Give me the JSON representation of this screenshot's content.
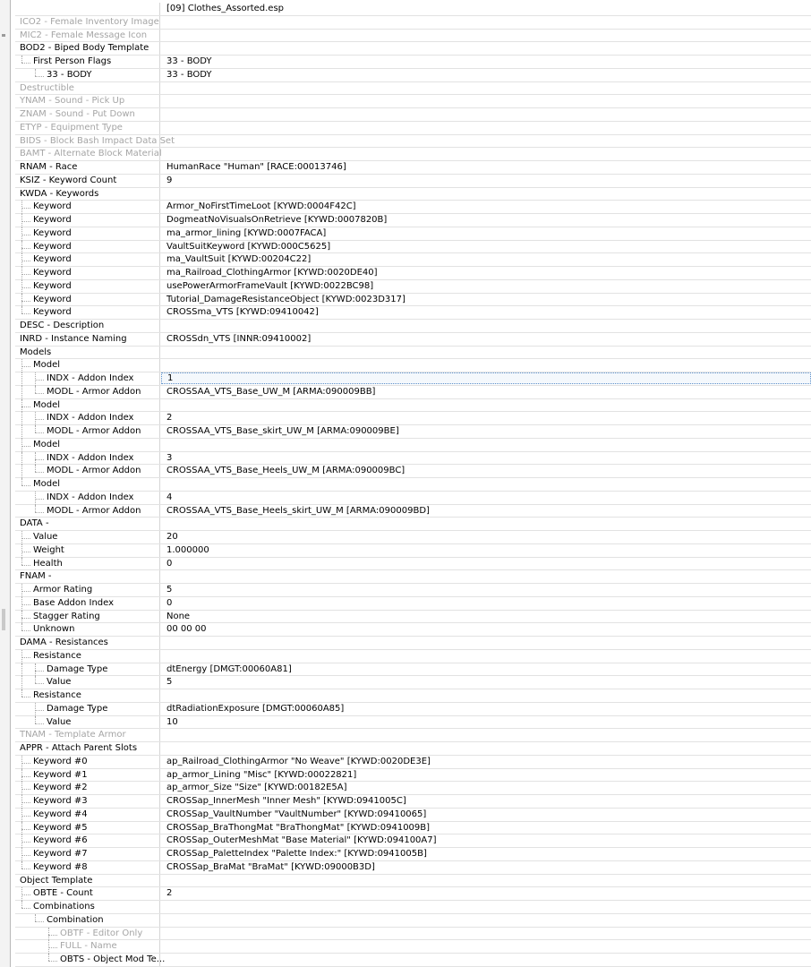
{
  "header_value": "[09] Clothes_Assorted.esp",
  "rows": [
    {
      "l": "ICO2 - Female Inventory Image",
      "v": "",
      "d": 0,
      "dim": true
    },
    {
      "l": "MIC2 - Female Message Icon",
      "v": "",
      "d": 0,
      "dim": true
    },
    {
      "l": "BOD2 - Biped Body Template",
      "v": "",
      "d": 0
    },
    {
      "l": "First Person Flags",
      "v": "33 - BODY",
      "d": 1
    },
    {
      "l": "33 - BODY",
      "v": "33 - BODY",
      "d": 2
    },
    {
      "l": "Destructible",
      "v": "",
      "d": 0,
      "dim": true
    },
    {
      "l": "YNAM - Sound - Pick Up",
      "v": "",
      "d": 0,
      "dim": true
    },
    {
      "l": "ZNAM - Sound - Put Down",
      "v": "",
      "d": 0,
      "dim": true
    },
    {
      "l": "ETYP - Equipment Type",
      "v": "",
      "d": 0,
      "dim": true
    },
    {
      "l": "BIDS - Block Bash Impact Data Set",
      "v": "",
      "d": 0,
      "dim": true
    },
    {
      "l": "BAMT - Alternate Block Material",
      "v": "",
      "d": 0,
      "dim": true
    },
    {
      "l": "RNAM - Race",
      "v": "HumanRace \"Human\" [RACE:00013746]",
      "d": 0
    },
    {
      "l": "KSIZ - Keyword Count",
      "v": "9",
      "d": 0
    },
    {
      "l": "KWDA - Keywords",
      "v": "",
      "d": 0
    },
    {
      "l": "Keyword",
      "v": "Armor_NoFirstTimeLoot [KYWD:0004F42C]",
      "d": 1
    },
    {
      "l": "Keyword",
      "v": "DogmeatNoVisualsOnRetrieve [KYWD:0007820B]",
      "d": 1
    },
    {
      "l": "Keyword",
      "v": "ma_armor_lining [KYWD:0007FACA]",
      "d": 1
    },
    {
      "l": "Keyword",
      "v": "VaultSuitKeyword [KYWD:000C5625]",
      "d": 1
    },
    {
      "l": "Keyword",
      "v": "ma_VaultSuit [KYWD:00204C22]",
      "d": 1
    },
    {
      "l": "Keyword",
      "v": "ma_Railroad_ClothingArmor [KYWD:0020DE40]",
      "d": 1
    },
    {
      "l": "Keyword",
      "v": "usePowerArmorFrameVault [KYWD:0022BC98]",
      "d": 1
    },
    {
      "l": "Keyword",
      "v": "Tutorial_DamageResistanceObject [KYWD:0023D317]",
      "d": 1
    },
    {
      "l": "Keyword",
      "v": "CROSSma_VTS [KYWD:09410042]",
      "d": 1
    },
    {
      "l": "DESC - Description",
      "v": "",
      "d": 0
    },
    {
      "l": "INRD - Instance Naming",
      "v": "CROSSdn_VTS [INNR:09410002]",
      "d": 0
    },
    {
      "l": "Models",
      "v": "",
      "d": 0
    },
    {
      "l": "Model",
      "v": "",
      "d": 1
    },
    {
      "l": "INDX - Addon Index",
      "v": "1",
      "d": 2,
      "sel": true
    },
    {
      "l": "MODL - Armor Addon",
      "v": "CROSSAA_VTS_Base_UW_M [ARMA:090009BB]",
      "d": 2
    },
    {
      "l": "Model",
      "v": "",
      "d": 1
    },
    {
      "l": "INDX - Addon Index",
      "v": "2",
      "d": 2
    },
    {
      "l": "MODL - Armor Addon",
      "v": "CROSSAA_VTS_Base_skirt_UW_M [ARMA:090009BE]",
      "d": 2
    },
    {
      "l": "Model",
      "v": "",
      "d": 1
    },
    {
      "l": "INDX - Addon Index",
      "v": "3",
      "d": 2
    },
    {
      "l": "MODL - Armor Addon",
      "v": "CROSSAA_VTS_Base_Heels_UW_M [ARMA:090009BC]",
      "d": 2
    },
    {
      "l": "Model",
      "v": "",
      "d": 1
    },
    {
      "l": "INDX - Addon Index",
      "v": "4",
      "d": 2
    },
    {
      "l": "MODL - Armor Addon",
      "v": "CROSSAA_VTS_Base_Heels_skirt_UW_M [ARMA:090009BD]",
      "d": 2
    },
    {
      "l": "DATA -",
      "v": "",
      "d": 0
    },
    {
      "l": "Value",
      "v": "20",
      "d": 1
    },
    {
      "l": "Weight",
      "v": "1.000000",
      "d": 1
    },
    {
      "l": "Health",
      "v": "0",
      "d": 1
    },
    {
      "l": "FNAM -",
      "v": "",
      "d": 0
    },
    {
      "l": "Armor Rating",
      "v": "5",
      "d": 1
    },
    {
      "l": "Base Addon Index",
      "v": "0",
      "d": 1
    },
    {
      "l": "Stagger Rating",
      "v": "None",
      "d": 1
    },
    {
      "l": "Unknown",
      "v": "00 00 00",
      "d": 1
    },
    {
      "l": "DAMA - Resistances",
      "v": "",
      "d": 0
    },
    {
      "l": "Resistance",
      "v": "",
      "d": 1
    },
    {
      "l": "Damage Type",
      "v": "dtEnergy [DMGT:00060A81]",
      "d": 2
    },
    {
      "l": "Value",
      "v": "5",
      "d": 2
    },
    {
      "l": "Resistance",
      "v": "",
      "d": 1
    },
    {
      "l": "Damage Type",
      "v": "dtRadiationExposure [DMGT:00060A85]",
      "d": 2
    },
    {
      "l": "Value",
      "v": "10",
      "d": 2
    },
    {
      "l": "TNAM - Template Armor",
      "v": "",
      "d": 0,
      "dim": true
    },
    {
      "l": "APPR - Attach Parent Slots",
      "v": "",
      "d": 0
    },
    {
      "l": "Keyword #0",
      "v": "ap_Railroad_ClothingArmor \"No Weave\" [KYWD:0020DE3E]",
      "d": 1
    },
    {
      "l": "Keyword #1",
      "v": "ap_armor_Lining \"Misc\" [KYWD:00022821]",
      "d": 1
    },
    {
      "l": "Keyword #2",
      "v": "ap_armor_Size \"Size\" [KYWD:00182E5A]",
      "d": 1
    },
    {
      "l": "Keyword #3",
      "v": "CROSSap_InnerMesh \"Inner Mesh\" [KYWD:0941005C]",
      "d": 1
    },
    {
      "l": "Keyword #4",
      "v": "CROSSap_VaultNumber \"VaultNumber\" [KYWD:09410065]",
      "d": 1
    },
    {
      "l": "Keyword #5",
      "v": "CROSSap_BraThongMat \"BraThongMat\" [KYWD:0941009B]",
      "d": 1
    },
    {
      "l": "Keyword #6",
      "v": "CROSSap_OuterMeshMat \"Base Material\" [KYWD:094100A7]",
      "d": 1
    },
    {
      "l": "Keyword #7",
      "v": "CROSSap_PaletteIndex \"Palette Index:\" [KYWD:0941005B]",
      "d": 1
    },
    {
      "l": "Keyword #8",
      "v": "CROSSap_BraMat \"BraMat\" [KYWD:09000B3D]",
      "d": 1
    },
    {
      "l": "Object Template",
      "v": "",
      "d": 0
    },
    {
      "l": "OBTE - Count",
      "v": "2",
      "d": 1
    },
    {
      "l": "Combinations",
      "v": "",
      "d": 1
    },
    {
      "l": "Combination",
      "v": "",
      "d": 2
    },
    {
      "l": "OBTF - Editor Only",
      "v": "",
      "d": 3,
      "dim": true
    },
    {
      "l": "FULL - Name",
      "v": "",
      "d": 3,
      "dim": true
    },
    {
      "l": "OBTS - Object Mod Te...",
      "v": "",
      "d": 3
    }
  ]
}
